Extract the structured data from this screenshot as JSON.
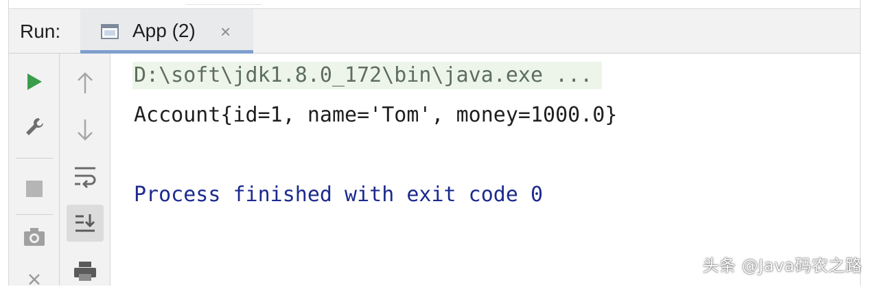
{
  "run_panel": {
    "label": "Run:",
    "tab": {
      "label": "App (2)",
      "close_glyph": "×",
      "icon": "app-window-icon"
    }
  },
  "toolbar_left": [
    {
      "name": "rerun-icon",
      "color": "#3a9d4a"
    },
    {
      "name": "wrench-icon",
      "color": "#6e6e6e"
    },
    {
      "name": "stop-icon",
      "color": "#b5b5b5"
    },
    {
      "name": "camera-icon",
      "color": "#9a9a9a"
    },
    {
      "name": "close-icon",
      "color": "#9a9a9a"
    }
  ],
  "toolbar_right": [
    {
      "name": "up-arrow-icon"
    },
    {
      "name": "down-arrow-icon"
    },
    {
      "name": "soft-wrap-icon"
    },
    {
      "name": "scroll-to-end-icon",
      "active": true
    },
    {
      "name": "print-icon"
    }
  ],
  "console": {
    "command": "D:\\soft\\jdk1.8.0_172\\bin\\java.exe ...",
    "output": "Account{id=1, name='Tom', money=1000.0}",
    "exit": "Process finished with exit code 0"
  },
  "watermark": "头条 @Java码农之路",
  "colors": {
    "command_text": "#5d6e5d",
    "command_bg": "#edf5ea",
    "exit_text": "#1c2a8f",
    "tab_underline": "#7f9fcd",
    "run_green": "#3a9d4a"
  }
}
